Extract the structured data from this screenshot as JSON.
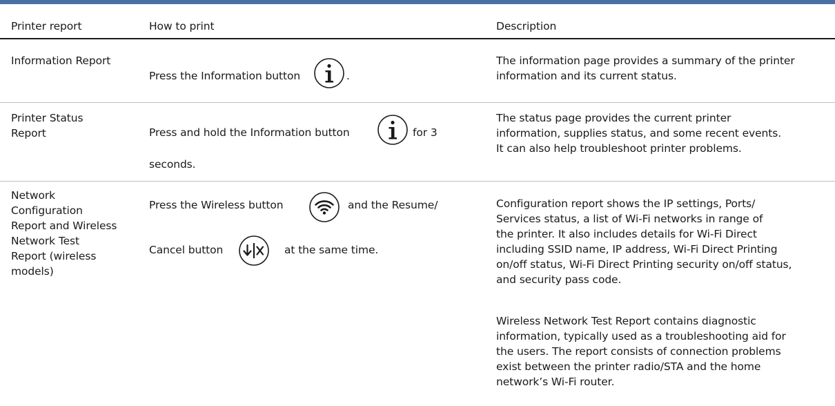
{
  "header": {
    "col_report": "Printer report",
    "col_how": "How to print",
    "col_desc": "Description"
  },
  "rows": [
    {
      "report": "Information Report",
      "how": {
        "line1": "Press the Information button",
        "line1_after": "."
      },
      "description": [
        "The information page provides a summary of the printer",
        "information and its current status."
      ]
    },
    {
      "report": [
        "Printer Status",
        "Report"
      ],
      "how": {
        "line1": "Press and hold the Information button",
        "line1_after": "for 3",
        "line2": "seconds."
      },
      "description": [
        "The status page provides the current printer",
        "information, supplies status, and some recent events.",
        "It can also help troubleshoot printer problems."
      ]
    },
    {
      "report": [
        "Network",
        "Configuration",
        "Report and Wireless",
        "Network Test",
        "Report (wireless",
        "models)"
      ],
      "how": {
        "line1": "Press the Wireless button",
        "line1_after": "and the Resume/",
        "line2": "Cancel button",
        "line2_after": "at the same time."
      },
      "description": [
        "Configuration report shows the IP settings, Ports/",
        "Services status, a list of Wi-Fi networks in range of",
        "the printer. It also includes details for Wi-Fi Direct",
        "including SSID name, IP address, Wi-Fi Direct Printing",
        "on/off status, Wi-Fi Direct Printing security on/off status,",
        "and security pass code."
      ],
      "description2": [
        "Wireless Network Test Report contains diagnostic",
        "information, typically used as a troubleshooting aid for",
        "the users. The report consists of connection problems",
        "exist between the printer radio/STA and the home",
        "network’s Wi-Fi router."
      ]
    }
  ],
  "icons": {
    "information": "information-icon",
    "wireless": "wireless-icon",
    "resume_cancel": "resume-cancel-icon"
  },
  "colors": {
    "top_rule": "#4a6fa5",
    "text": "#1a1a1a",
    "row_rule": "#bfbfbf"
  }
}
